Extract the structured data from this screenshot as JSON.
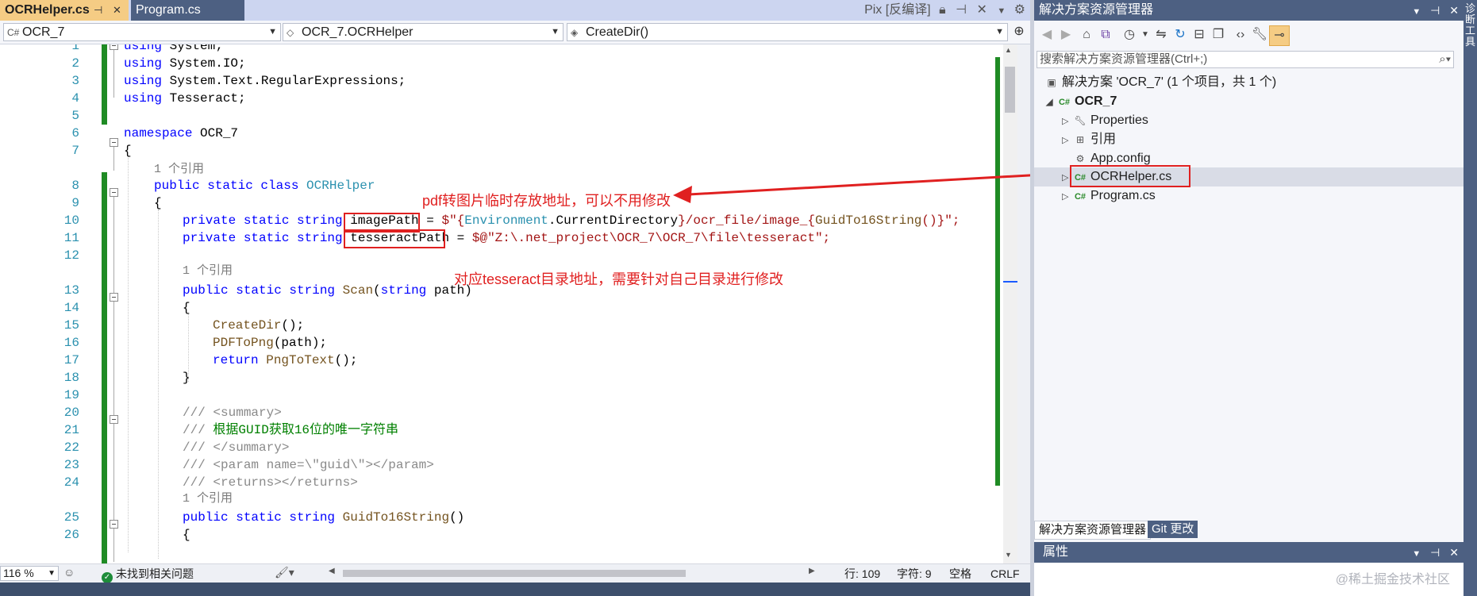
{
  "tabs": {
    "active": "OCRHelper.cs",
    "active_icons": "⊕ ✕",
    "other": "Program.cs",
    "right_label": "Pix [反编译]"
  },
  "navbar": {
    "project": "OCR_7",
    "class": "OCR_7.OCRHelper",
    "member": "CreateDir()"
  },
  "line_numbers": [
    "1",
    "2",
    "3",
    "4",
    "5",
    "6",
    "7",
    "8",
    "9",
    "10",
    "11",
    "12",
    "13",
    "14",
    "15",
    "16",
    "17",
    "18",
    "19",
    "20",
    "21",
    "22",
    "23",
    "24",
    "25",
    "26"
  ],
  "code": {
    "l1_kw": "using",
    "l1_rest": " System;",
    "l2_kw": "using",
    "l2_rest": " System.IO;",
    "l3_kw": "using",
    "l3_rest": " System.Text.RegularExpressions;",
    "l4_kw": "using",
    "l4_rest": " Tesseract;",
    "l6_kw": "namespace",
    "l6_rest": " OCR_7",
    "brace_open": "{",
    "brace_close": "}",
    "ref1": "1 个引用",
    "l8_kw": "public static class",
    "l8_type": " OCRHelper",
    "l10_kw": "private static string",
    "l10_name": " imagePath",
    "l10_eq": " = ",
    "l10_str1": "$\"{",
    "l10_env": "Environment",
    "l10_mid": ".CurrentDirectory",
    "l10_str2": "}/ocr_file/image_{",
    "l10_call": "GuidTo16String",
    "l10_str3": "()}\";",
    "l11_kw": "private static string",
    "l11_name": " tesseractPath",
    "l11_eq": " = ",
    "l11_str": "$@\"Z:\\.net_project\\OCR_7\\OCR_7\\file\\tesseract\";",
    "ref2": "1 个引用",
    "l13_kw": "public static string",
    "l13_name": " Scan",
    "l13_open": "(",
    "l13_kw2": "string",
    "l13_close": " path)",
    "l15": "CreateDir",
    "l15_tail": "();",
    "l16": "PDFToPng",
    "l16_tail": "(path);",
    "l17_kw": "return",
    "l17_name": " PngToText",
    "l17_tail": "();",
    "l20": "/// <summary>",
    "l21_cm": "/// ",
    "l21_text": "根据GUID获取16位的唯一字符串",
    "l22": "/// </summary>",
    "l23": "/// <param name=\\\"guid\\\"></param>",
    "l24": "/// <returns></returns>",
    "ref3": "1 个引用",
    "l25_kw": "public static string",
    "l25_name": " GuidTo16String",
    "l25_tail": "()"
  },
  "annotations": {
    "image_note": "pdf转图片临时存放地址，可以不用修改",
    "tess_note": "对应tesseract目录地址，需要针对自己目录进行修改"
  },
  "statusbar": {
    "zoom": "116 %",
    "issues": "未找到相关问题",
    "line": "行: 109",
    "char": "字符: 9",
    "space": "空格",
    "eol": "CRLF"
  },
  "solution_explorer": {
    "title": "解决方案资源管理器",
    "search_placeholder": "搜索解决方案资源管理器(Ctrl+;)",
    "solution": "解决方案 'OCR_7' (1 个项目，共 1 个)",
    "project": "OCR_7",
    "items": [
      "Properties",
      "引用",
      "App.config",
      "OCRHelper.cs",
      "Program.cs"
    ],
    "tab_solution": "解决方案资源管理器",
    "tab_git": "Git 更改"
  },
  "properties": {
    "title": "属性"
  },
  "watermark": "@稀土掘金技术社区",
  "right_strip": "诊断工具",
  "colors": {
    "accent_tab": "#f5cc84",
    "panel_title": "#4d6082",
    "annotation_red": "#e02020",
    "change_green": "#1f8b24"
  }
}
